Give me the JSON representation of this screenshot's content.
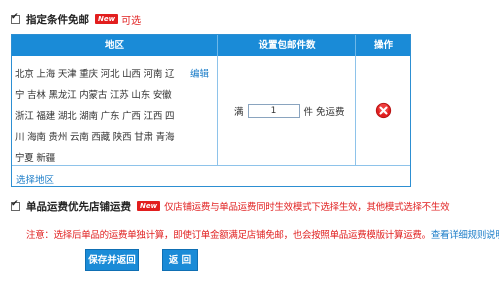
{
  "free_shipping": {
    "label": "指定条件免邮",
    "new_badge": "New",
    "optional": "可选",
    "checked": true
  },
  "table": {
    "headers": [
      "地区",
      "设置包邮件数",
      "操作"
    ],
    "region_text": "北京 上海 天津 重庆 河北 山西 河南 辽宁 吉林 黑龙江 内蒙古 江苏 山东 安徽 浙江 福建 湖北 湖南 广东 广西 江西 四川 海南 贵州 云南 西藏 陕西 甘肃 青海 宁夏 新疆",
    "edit_label": "编辑",
    "count_prefix": "满",
    "count_value": "1",
    "count_suffix": "件 免运费",
    "delete_icon": "delete-icon",
    "select_region_label": "选择地区"
  },
  "single_priority": {
    "label": "单品运费优先店铺运费",
    "new_badge": "New",
    "warning": "仅店铺运费与单品运费同时生效模式下选择生效，其他模式选择不生效",
    "checked": true
  },
  "note": {
    "text": "注意：选择后单品的运费单独计算，即使订单金额满足店铺免邮，也会按照单品运费模版计算运费。",
    "link": "查看详细规则说明"
  },
  "buttons": {
    "save": "保存并返回",
    "back": "返 回"
  },
  "colors": {
    "header_blue": "#1a8bd7",
    "link_blue": "#1a7cc8",
    "warning_red": "#e12222"
  }
}
